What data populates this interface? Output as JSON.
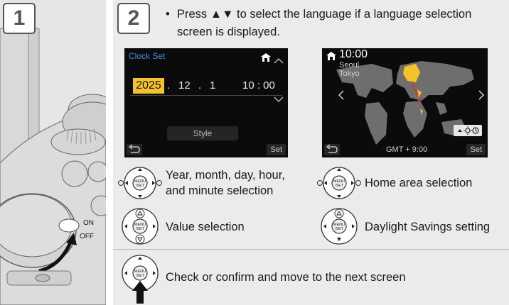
{
  "step1": {
    "number": "1",
    "on_label": "ON",
    "off_label": "OFF"
  },
  "step2": {
    "number": "2",
    "bullet": "•",
    "instruction": "Press ▲▼ to select the language if a language selection screen is displayed."
  },
  "clock_screen": {
    "title": "Clock Set",
    "year": "2025",
    "month": "12",
    "day": "1",
    "time": "10 : 00",
    "style_label": "Style",
    "set_label": "Set",
    "sep1": ".",
    "sep2": "."
  },
  "home_screen": {
    "time": "10:00",
    "city1": "Seoul",
    "city2": "Tokyo",
    "gmt": "GMT +   9:00",
    "set_label": "Set"
  },
  "descriptions": {
    "ymd_selection": [
      "Year, month, day, hour,",
      "and minute selection"
    ],
    "value_selection": "Value selection",
    "home_area_selection": "Home area selection",
    "daylight_savings": "Daylight Savings setting",
    "confirm": "Check or confirm and move to the next screen"
  },
  "dial_text": {
    "line1": "MENU",
    "line2": "/SET"
  },
  "colors": {
    "highlight": "#f6c324",
    "title_blue": "#3d8fe0",
    "screen_bg": "#0b0b0b",
    "panel_bg": "#ebebeb"
  }
}
